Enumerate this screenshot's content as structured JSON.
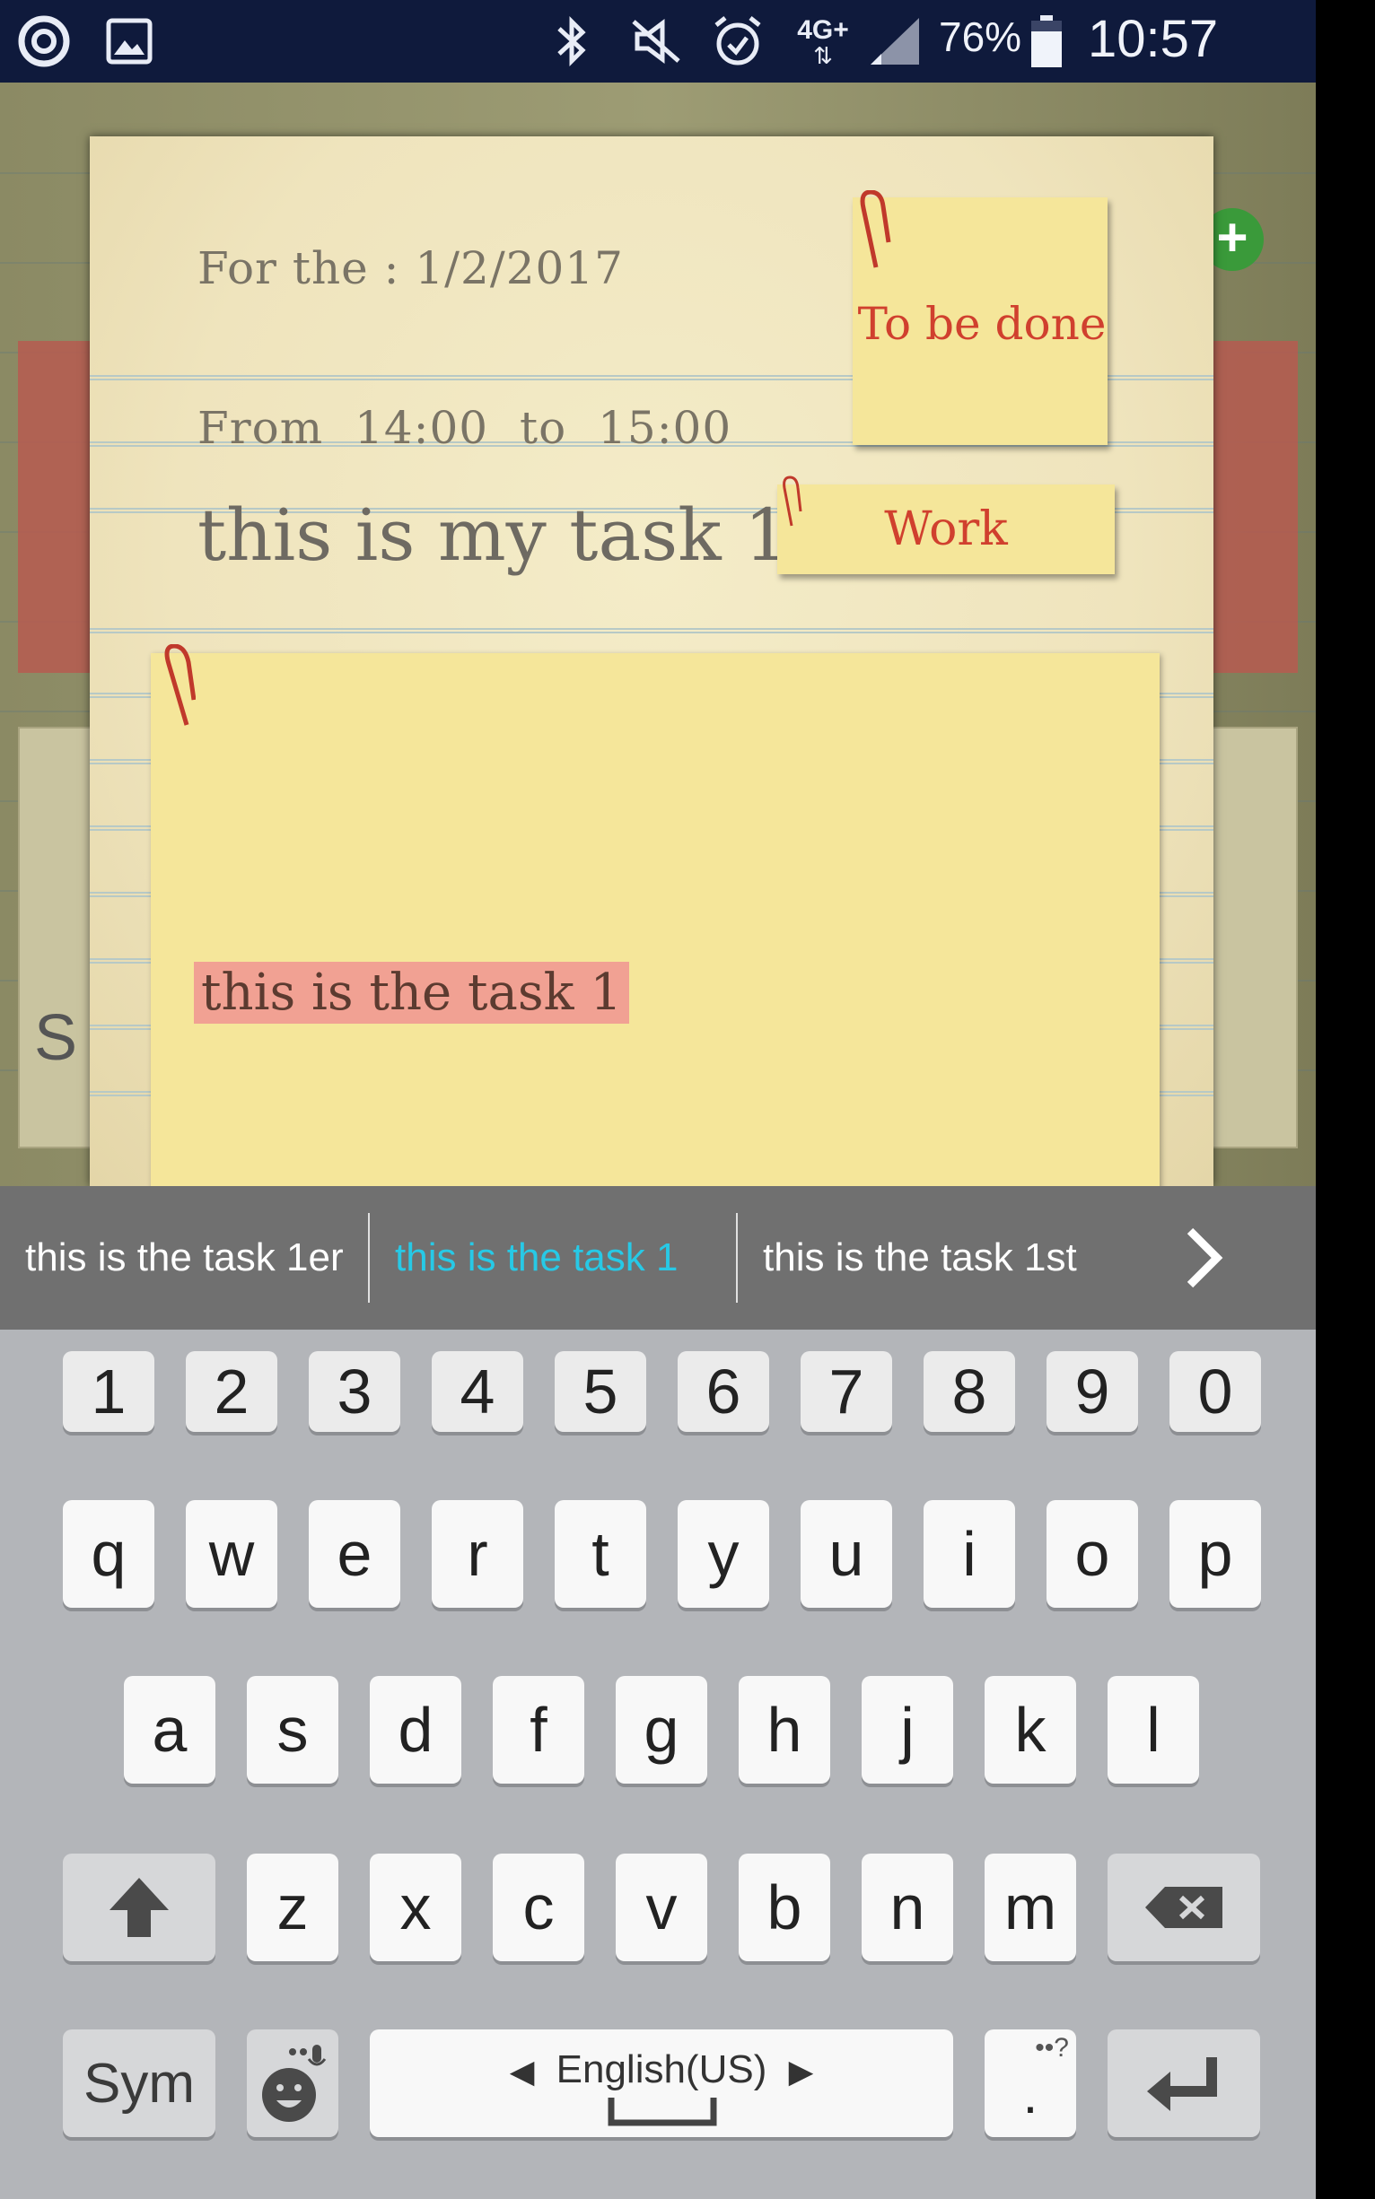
{
  "status_bar": {
    "battery": "76%",
    "time": "10:57",
    "network": "4G+",
    "icons": [
      "app-icon",
      "image-icon",
      "bluetooth-icon",
      "mute-icon",
      "alarm-icon",
      "network-icon",
      "signal-icon",
      "battery-icon"
    ]
  },
  "task": {
    "date_line": "For the : 1/2/2017",
    "time_line": "From 14:00 to 15:00",
    "title": "this is my task 1",
    "status": "To be done",
    "category": "Work",
    "note": "this is the task 1"
  },
  "background": {
    "partial_letter": "S"
  },
  "suggestions": {
    "items": [
      "this is the task 1er",
      "this is the task 1",
      "this is the task 1st"
    ],
    "active_index": 1
  },
  "keyboard": {
    "number_row": [
      "1",
      "2",
      "3",
      "4",
      "5",
      "6",
      "7",
      "8",
      "9",
      "0"
    ],
    "row1": [
      "q",
      "w",
      "e",
      "r",
      "t",
      "y",
      "u",
      "i",
      "o",
      "p"
    ],
    "row2": [
      "a",
      "s",
      "d",
      "f",
      "g",
      "h",
      "j",
      "k",
      "l"
    ],
    "row3": [
      "z",
      "x",
      "c",
      "v",
      "b",
      "n",
      "m"
    ],
    "sym_label": "Sym",
    "language_label": "English(US)",
    "period_key": ".",
    "period_hint": "••?"
  },
  "colors": {
    "status_bar": "#0f1a3c",
    "sticky": "#f5e69a",
    "status_red": "#d0402e",
    "note_highlight": "#f1a193",
    "suggestion_active": "#27c9e6"
  }
}
